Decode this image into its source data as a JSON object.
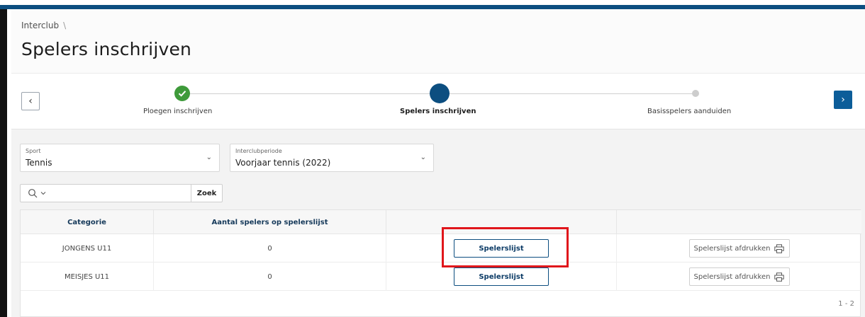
{
  "breadcrumb": {
    "parent": "Interclub",
    "separator": "\\"
  },
  "page_title": "Spelers inschrijven",
  "wizard": {
    "prev_label": "‹",
    "next_label": "›",
    "steps": [
      {
        "label": "Ploegen inschrijven",
        "status": "done"
      },
      {
        "label": "Spelers inschrijven",
        "status": "current"
      },
      {
        "label": "Basisspelers aanduiden",
        "status": "future"
      }
    ]
  },
  "filters": {
    "sport": {
      "label": "Sport",
      "value": "Tennis"
    },
    "period": {
      "label": "Interclubperiode",
      "value": "Voorjaar tennis (2022)"
    }
  },
  "search": {
    "placeholder": "",
    "button_label": "Zoek"
  },
  "table": {
    "columns": [
      "Categorie",
      "Aantal spelers op spelerslijst",
      "",
      ""
    ],
    "rows": [
      {
        "categorie": "JONGENS U11",
        "aantal": "0",
        "action": "Spelerslijst",
        "print": "Spelerslijst afdrukken"
      },
      {
        "categorie": "MEISJES U11",
        "aantal": "0",
        "action": "Spelerslijst",
        "print": "Spelerslijst afdrukken"
      }
    ],
    "pagination": "1 - 2"
  },
  "colors": {
    "brand": "#0c4e80",
    "success": "#3e9a3a",
    "highlight": "#e0161b"
  }
}
